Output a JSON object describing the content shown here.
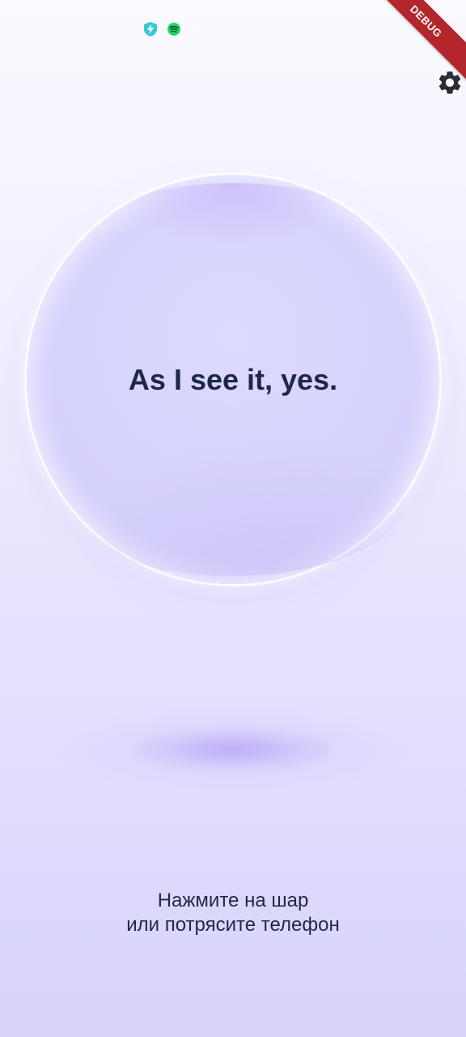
{
  "status_bar": {
    "icons": [
      "shield-bolt-icon",
      "spotify-icon",
      "notification-dot-icon"
    ]
  },
  "debug_banner": {
    "label": "DEBUG",
    "color": "#b3262b"
  },
  "settings": {
    "icon": "gear-icon"
  },
  "orb": {
    "answer": "As I see it, yes."
  },
  "hint": {
    "line1": "Нажмите на шар",
    "line2": "или потрясите телефон"
  },
  "colors": {
    "text": "#1e2746",
    "orb": "#d6d3fd",
    "background_top": "#fbfaff",
    "background_bottom": "#d7d3fb"
  }
}
